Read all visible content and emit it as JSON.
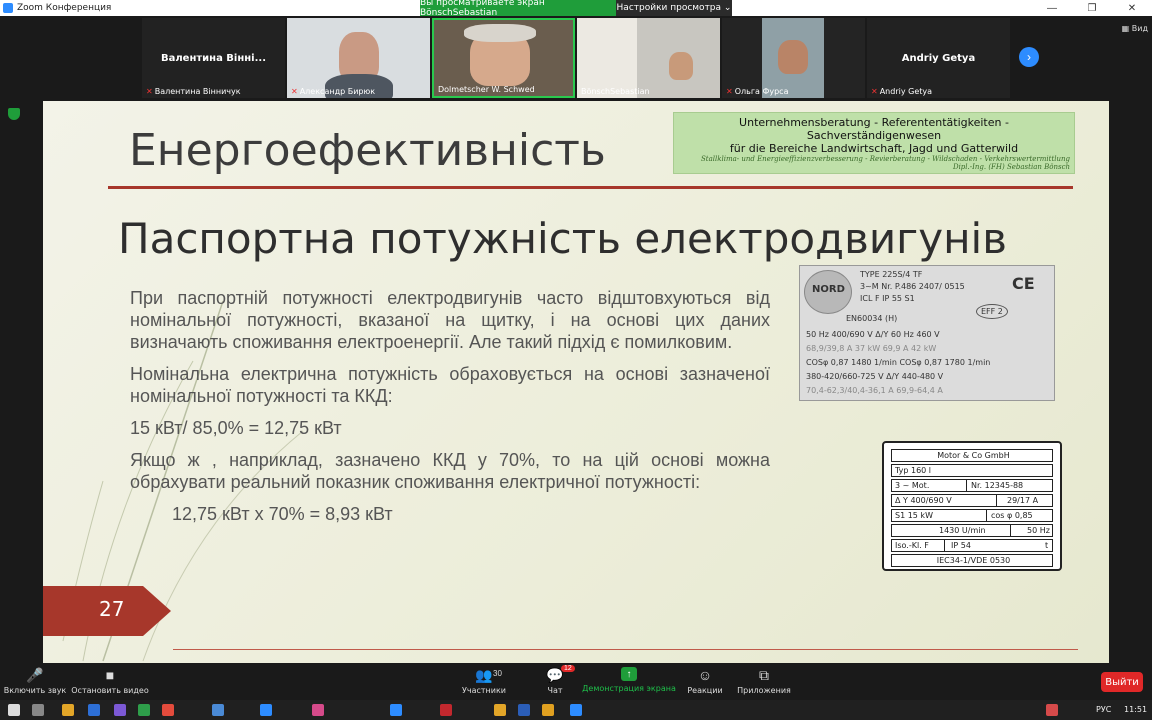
{
  "window": {
    "title": "Zoom Конференция"
  },
  "share_banner": {
    "viewing": "Вы просматриваете экран BönschSebastian",
    "view_settings": "Настройки просмотра ⌄"
  },
  "gallery": {
    "participants": [
      {
        "name": "Валентина Вінні...",
        "label": "Валентина Вінничук",
        "video": false
      },
      {
        "name": "Александр Бирюк",
        "label": "Александр Бирюк",
        "video": true
      },
      {
        "name": "Dolmetscher W. Schwed",
        "label": "Dolmetscher W. Schwed",
        "video": true
      },
      {
        "name": "BönschSebastian",
        "label": "BönschSebastian",
        "video": true
      },
      {
        "name": "Ольга Фурса",
        "label": "Ольга Фурса",
        "video": true
      },
      {
        "name": "Andriy Getya",
        "label": "Andriy Getya",
        "video": false
      }
    ],
    "view_label": "Вид"
  },
  "slide": {
    "title": "Енергоефективність",
    "logo": {
      "line1": "Unternehmensberatung  -  Referententätigkeiten  - Sachverständigenwesen",
      "line2": "für die Bereiche Landwirtschaft, Jagd und Gatterwild",
      "line3": "Stallklima- und Energieeffizienzverbesserung - Revierberatung - Wildschaden - Verkehrswertermittlung",
      "line4": "Dipl.-Ing. (FH) Sebastian Bönsch"
    },
    "heading": "Паспортна потужність електродвигунів",
    "paragraphs": [
      "При паспортній потужності електродвигунів часто відштовхуються від номінальної потужності, вказаної на щитку, і на основі цих даних визначають споживання електроенергії. Але такий підхід є помилковим.",
      "Номінальна електрична потужність обраховується на основі зазначеної номінальної потужності та ККД:",
      "15 кВт/ 85,0% = 12,75 кВт",
      "Якщо ж , наприклад, зазначено ККД у 70%, то на цій основі можна обрахувати реальний показник споживання електричної потужності:",
      "12,75 кВт х 70% = 8,93 кВт"
    ],
    "number": "27",
    "nameplate_photo": {
      "brand": "NORD",
      "type": "TYPE  225S/4  TF",
      "line2": "3~M  Nr. P.486 2407/ 0515",
      "line3": "ICL F  IP 55  S1",
      "standard": "EN60034 (H)",
      "ce": "CE",
      "eff": "EFF 2",
      "row1": "50 Hz   400/690 V   Δ/Y   60 Hz   460 V",
      "row2": "68,9/39,8 A   37 kW   69,9 A   42 kW",
      "row3": "COSφ 0,87   1480 1/min   COSφ 0,87   1780 1/min",
      "row4": "380-420/660-725 V  Δ/Y   440-480 V",
      "row5": "70,4-62,3/40,4-36,1 A   69,9-64,4 A"
    },
    "nameplate_drawing": {
      "maker": "Motor & Co GmbH",
      "typ": "Typ   160 l",
      "phase": "3 ~ Mot.",
      "nr": "Nr.    12345-88",
      "voltage": "Δ Y    400/690 V",
      "current": "29/17    A",
      "duty": "S1       15  kW",
      "cos": "cos φ   0,85",
      "rpm": "1430  U/min",
      "freq": "50 Hz",
      "iso": "Iso.-Kl. F",
      "ip": "IP   54",
      "t": "t",
      "standard": "IEC34-1/VDE 0530"
    }
  },
  "toolbar": {
    "audio": "Включить звук",
    "video": "Остановить видео",
    "participants": "Участники",
    "participants_count": "30",
    "chat": "Чат",
    "chat_badge": "12",
    "share": "Демонстрация экрана",
    "reactions": "Реакции",
    "apps": "Приложения",
    "exit": "Выйти"
  },
  "taskbar": {
    "lang": "РУС",
    "time": "11:51"
  },
  "colors": {
    "accent": "#a7372b",
    "zoom_blue": "#2d8cff",
    "share_green": "#1f9d3a",
    "exit_red": "#e02828"
  }
}
